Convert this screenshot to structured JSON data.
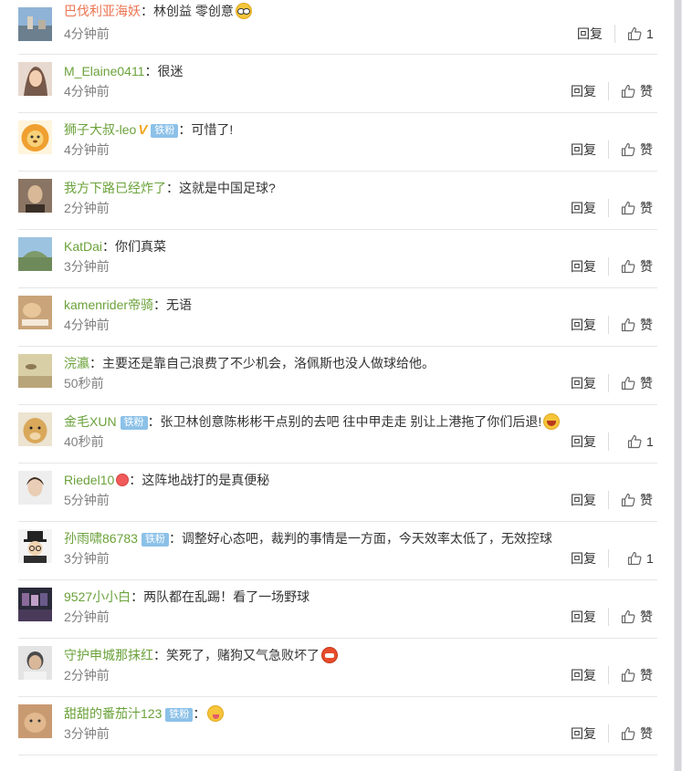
{
  "comments": [
    {
      "user": "巴伐利亚海妖",
      "user_color": "#eb7350",
      "text": "：林创益 零创意",
      "emoji": "glasses-emoji",
      "time": "4分钟前",
      "reply": "回复",
      "like": "1"
    },
    {
      "user": "M_Elaine0411",
      "user_color": "#6ba23b",
      "text": "：很迷",
      "time": "4分钟前",
      "reply": "回复",
      "like": "赞"
    },
    {
      "user": "狮子大叔-leo",
      "user_color": "#6ba23b",
      "vip": "V",
      "badge": "铁粉",
      "text": "：可惜了!",
      "time": "4分钟前",
      "reply": "回复",
      "like": "赞"
    },
    {
      "user": "我方下路已经炸了",
      "user_color": "#6ba23b",
      "text": "：这就是中国足球?",
      "time": "2分钟前",
      "reply": "回复",
      "like": "赞"
    },
    {
      "user": "KatDai",
      "user_color": "#6ba23b",
      "text": "：你们真菜",
      "time": "3分钟前",
      "reply": "回复",
      "like": "赞"
    },
    {
      "user": "kamenrider帝骑",
      "user_color": "#6ba23b",
      "text": "：无语",
      "time": "4分钟前",
      "reply": "回复",
      "like": "赞"
    },
    {
      "user": "浣瀛",
      "user_color": "#6ba23b",
      "text": "：主要还是靠自己浪费了不少机会，洛佩斯也没人做球给他。",
      "time": "50秒前",
      "reply": "回复",
      "like": "赞"
    },
    {
      "user": "金毛XUN",
      "user_color": "#6ba23b",
      "badge": "铁粉",
      "text": "：张卫林创意陈彬彬干点别的去吧 往中甲走走 别让上港拖了你们后退!",
      "emoji": "laugh-emoji",
      "time": "40秒前",
      "reply": "回复",
      "like": "1"
    },
    {
      "user": "Riedel10",
      "user_color": "#6ba23b",
      "user_emoji": "love-emoji",
      "text": "：这阵地战打的是真便秘",
      "time": "5分钟前",
      "reply": "回复",
      "like": "赞"
    },
    {
      "user": "孙雨啸86783",
      "user_color": "#6ba23b",
      "badge": "铁粉",
      "text": "：调整好心态吧，裁判的事情是一方面，今天效率太低了，无效控球",
      "time": "3分钟前",
      "reply": "回复",
      "like": "1"
    },
    {
      "user": "9527小小白",
      "user_color": "#6ba23b",
      "text": "：两队都在乱踢！看了一场野球",
      "time": "2分钟前",
      "reply": "回复",
      "like": "赞"
    },
    {
      "user": "守护申城那抹红",
      "user_color": "#6ba23b",
      "text": "：笑死了，赌狗又气急败坏了",
      "emoji": "angry-emoji",
      "time": "2分钟前",
      "reply": "回复",
      "like": "赞"
    },
    {
      "user": "甜甜的番茄汁123",
      "user_color": "#6ba23b",
      "badge": "铁粉",
      "text": "：",
      "emoji": "tongue-emoji",
      "time": "3分钟前",
      "reply": "回复",
      "like": "赞"
    }
  ],
  "colors": {
    "username_first": "#eb7350",
    "username": "#6ba23b",
    "badge_bg": "#8cc1e8",
    "time": "#808080",
    "divider": "#e6e6e6"
  }
}
